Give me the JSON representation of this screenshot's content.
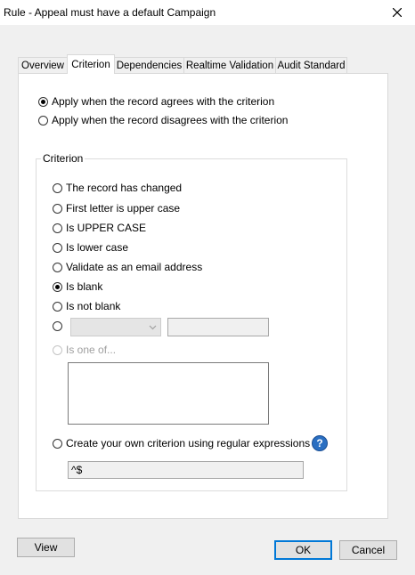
{
  "window": {
    "title": "Rule - Appeal must have a default Campaign"
  },
  "tabs": [
    {
      "label": "Overview"
    },
    {
      "label": "Criterion"
    },
    {
      "label": "Dependencies"
    },
    {
      "label": "Realtime Validation"
    },
    {
      "label": "Audit Standard"
    }
  ],
  "active_tab": "Criterion",
  "apply": {
    "agrees": "Apply when the record agrees with the criterion",
    "disagrees": "Apply when the record disagrees with the criterion",
    "selected": "agrees"
  },
  "criterion": {
    "group_label": "Criterion",
    "options": {
      "changed": "The record has changed",
      "first_upper": "First letter is upper case",
      "upper": "Is UPPER CASE",
      "lower": "Is lower case",
      "email": "Validate as an email address",
      "blank": "Is blank",
      "not_blank": "Is not blank",
      "one_of": "Is one of...",
      "regex": "Create your own criterion using regular expressions"
    },
    "selected": "blank",
    "regex_value": "^$",
    "combo_value": "",
    "compare_value": ""
  },
  "buttons": {
    "view": "View",
    "ok": "OK",
    "cancel": "Cancel"
  },
  "colors": {
    "accent": "#0078d7",
    "help": "#2a6fc2"
  }
}
